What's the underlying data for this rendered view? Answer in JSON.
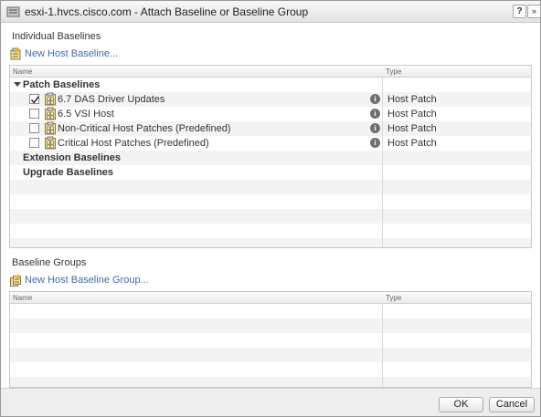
{
  "dialog": {
    "title": "esxi-1.hvcs.cisco.com - Attach Baseline or Baseline Group",
    "help_label": "?",
    "forward_label": "»"
  },
  "individual": {
    "section_title": "Individual Baselines",
    "new_link": "New Host Baseline...",
    "columns": {
      "name": "Name",
      "type": "Type"
    },
    "groups": [
      {
        "label": "Patch Baselines",
        "expanded": true
      },
      {
        "label": "Extension Baselines"
      },
      {
        "label": "Upgrade Baselines"
      }
    ],
    "items": [
      {
        "name": "6.7 DAS Driver Updates",
        "type": "Host Patch",
        "checked": true
      },
      {
        "name": "6.5 VSI Host",
        "type": "Host Patch",
        "checked": false
      },
      {
        "name": "Non-Critical Host Patches (Predefined)",
        "type": "Host Patch",
        "checked": false
      },
      {
        "name": "Critical Host Patches (Predefined)",
        "type": "Host Patch",
        "checked": false
      }
    ]
  },
  "groups_section": {
    "section_title": "Baseline Groups",
    "new_link": "New Host Baseline Group...",
    "columns": {
      "name": "Name",
      "type": "Type"
    }
  },
  "footer": {
    "ok_label": "OK",
    "cancel_label": "Cancel"
  },
  "colors": {
    "link": "#3b6db0",
    "stripe": "#f3f3f3",
    "footer": "#eeeeee"
  }
}
